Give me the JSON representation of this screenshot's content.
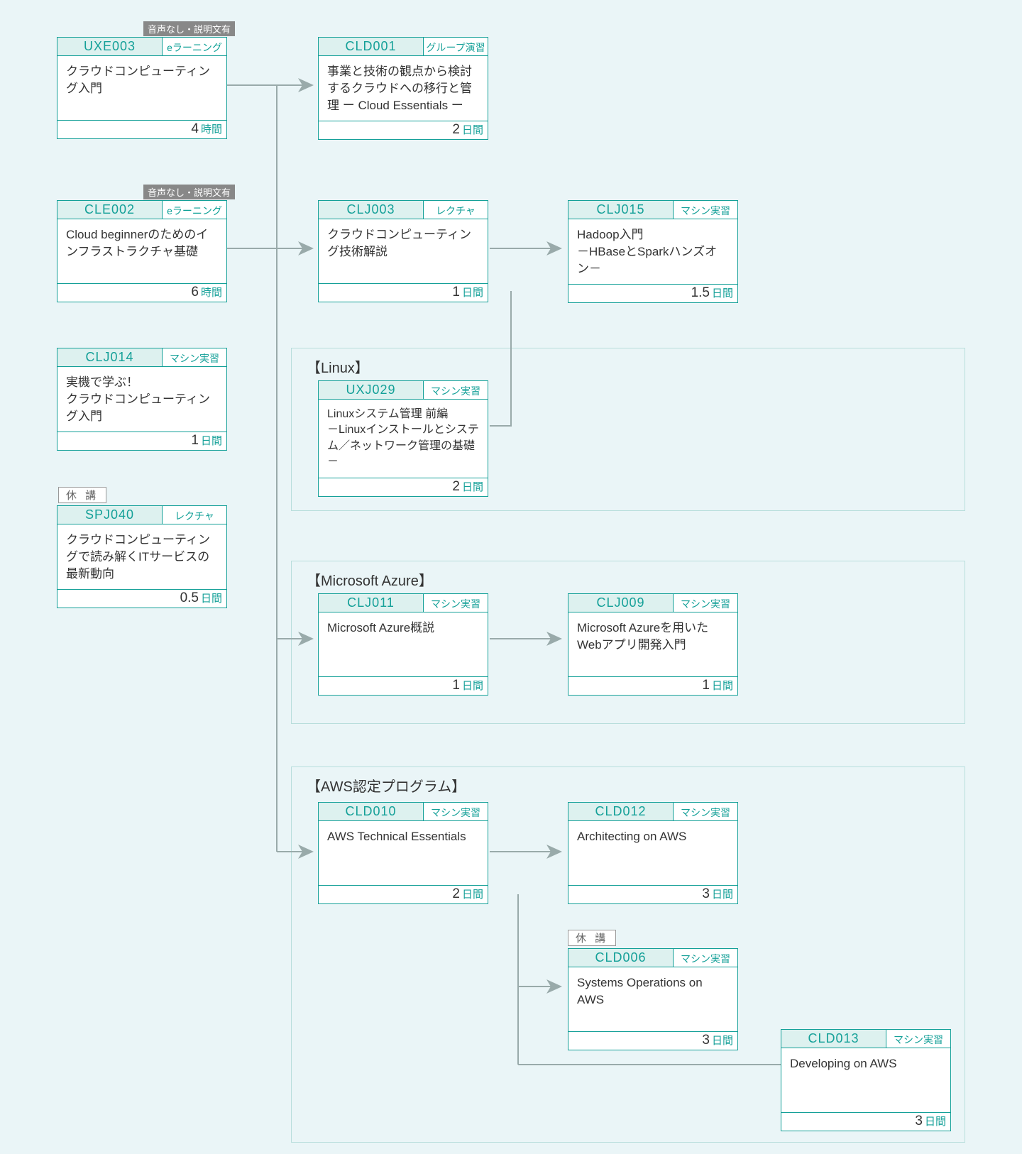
{
  "notes": {
    "no_audio_has_desc": "音声なし・説明文有",
    "suspended": "休 講"
  },
  "groups": {
    "linux": "【Linux】",
    "azure": "【Microsoft Azure】",
    "aws": "【AWS認定プログラム】"
  },
  "cards": {
    "uxe003": {
      "code": "UXE003",
      "tag": "eラーニング",
      "title": "クラウドコンピューティング入門",
      "dur": "4",
      "unit": "時間"
    },
    "cld001": {
      "code": "CLD001",
      "tag": "グループ演習",
      "title": "事業と技術の観点から検討するクラウドへの移行と管理 ー Cloud Essentials ー",
      "dur": "2",
      "unit": "日間"
    },
    "cle002": {
      "code": "CLE002",
      "tag": "eラーニング",
      "title": "Cloud beginnerのためのインフラストラクチャ基礎",
      "dur": "6",
      "unit": "時間"
    },
    "clj003": {
      "code": "CLJ003",
      "tag": "レクチャ",
      "title": "クラウドコンピューティング技術解説",
      "dur": "1",
      "unit": "日間"
    },
    "clj015": {
      "code": "CLJ015",
      "tag": "マシン実習",
      "title": "Hadoop入門\n－HBaseとSparkハンズオン－",
      "dur": "1.5",
      "unit": "日間"
    },
    "clj014": {
      "code": "CLJ014",
      "tag": "マシン実習",
      "title": "実機で学ぶ！\nクラウドコンピューティング入門",
      "dur": "1",
      "unit": "日間"
    },
    "uxj029": {
      "code": "UXJ029",
      "tag": "マシン実習",
      "title": "Linuxシステム管理 前編\n－Linuxインストールとシステム／ネットワーク管理の基礎－",
      "dur": "2",
      "unit": "日間"
    },
    "spj040": {
      "code": "SPJ040",
      "tag": "レクチャ",
      "title": "クラウドコンピューティングで読み解くITサービスの\n最新動向",
      "dur": "0.5",
      "unit": "日間"
    },
    "clj011": {
      "code": "CLJ011",
      "tag": "マシン実習",
      "title": "Microsoft Azure概説",
      "dur": "1",
      "unit": "日間"
    },
    "clj009": {
      "code": "CLJ009",
      "tag": "マシン実習",
      "title": "Microsoft Azureを用いたWebアプリ開発入門",
      "dur": "1",
      "unit": "日間"
    },
    "cld010": {
      "code": "CLD010",
      "tag": "マシン実習",
      "title": "AWS Technical Essentials",
      "dur": "2",
      "unit": "日間"
    },
    "cld012": {
      "code": "CLD012",
      "tag": "マシン実習",
      "title": "Architecting on AWS",
      "dur": "3",
      "unit": "日間"
    },
    "cld006": {
      "code": "CLD006",
      "tag": "マシン実習",
      "title": "Systems Operations on AWS",
      "dur": "3",
      "unit": "日間"
    },
    "cld013": {
      "code": "CLD013",
      "tag": "マシン実習",
      "title": "Developing on AWS",
      "dur": "3",
      "unit": "日間"
    }
  }
}
